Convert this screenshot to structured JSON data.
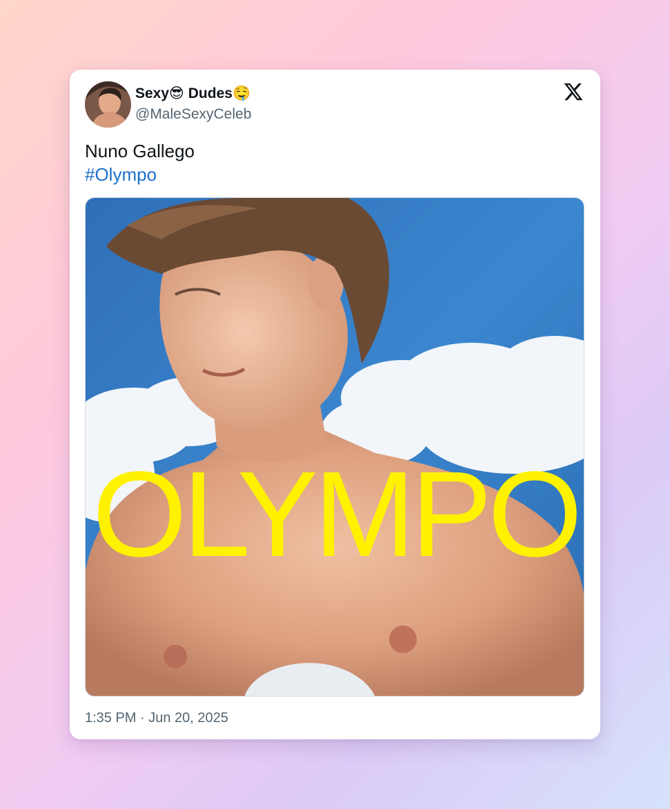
{
  "tweet": {
    "display_name": "Sexy😎 Dudes🤤",
    "handle": "@MaleSexyCeleb",
    "text": "Nuno Gallego",
    "hashtag": "#Olympo",
    "timestamp": "1:35 PM · Jun 20, 2025",
    "platform_icon": "x-logo-icon",
    "media_overlay_text": "OLYMPO"
  },
  "colors": {
    "hashtag": "#1d70c9",
    "overlay_text": "#fff200",
    "name": "#0f1419",
    "secondary": "#536471"
  }
}
